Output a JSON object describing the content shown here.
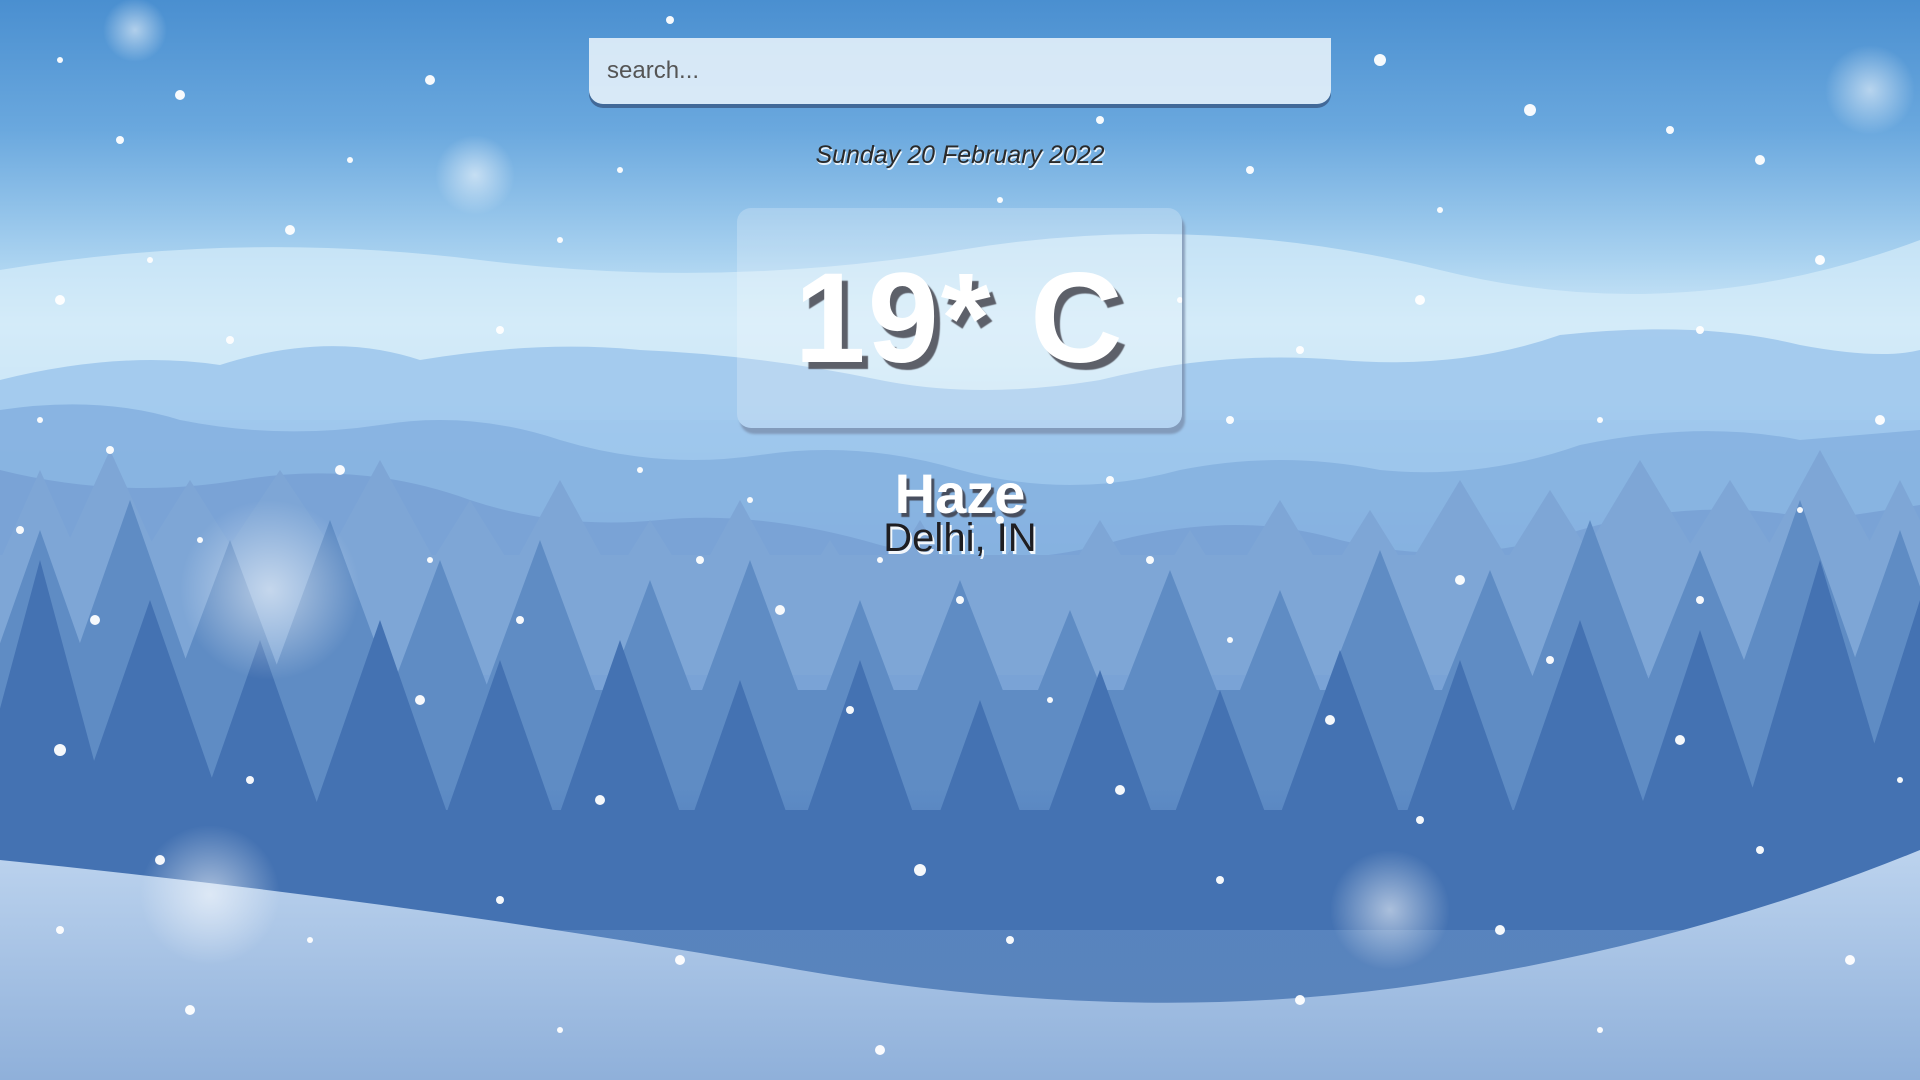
{
  "search": {
    "placeholder": "search..."
  },
  "date": "Sunday 20 February 2022",
  "weather": {
    "temperature": "19* C",
    "condition": "Haze",
    "location": "Delhi, IN"
  },
  "colors": {
    "sky_top": "#4a8fd0",
    "sky_haze": "#cfe8f8",
    "trees_far": "#7ea6d6",
    "trees_near": "#3d68a8",
    "snow_ground": "#a6c3e4"
  }
}
